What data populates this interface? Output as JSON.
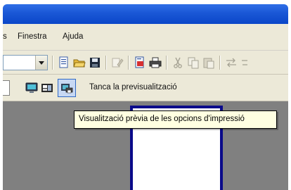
{
  "menubar": {
    "items": [
      "s",
      "Finestra",
      "Ajuda"
    ]
  },
  "toolbar2": {
    "close_preview_label": "Tanca la previsualització"
  },
  "tooltip": {
    "text": "Visualització prèvia de les opcions d'impressió"
  },
  "icons": {
    "toolbar1": [
      "dropdown-arrow-icon",
      "new-document-icon",
      "open-folder-icon",
      "save-icon",
      "edit-icon",
      "pdf-icon",
      "print-icon",
      "cut-icon",
      "copy-icon",
      "paste-icon",
      "arrows-icon"
    ],
    "toolbar2": [
      "print-preview-icon",
      "page-setup-icon",
      "print-options-preview-icon"
    ]
  },
  "colors": {
    "titlebar": "#1a57d6",
    "chrome": "#ece9d8",
    "workspace": "#808080",
    "page_border": "#0a0a8a",
    "tooltip_bg": "#ffffe1"
  }
}
